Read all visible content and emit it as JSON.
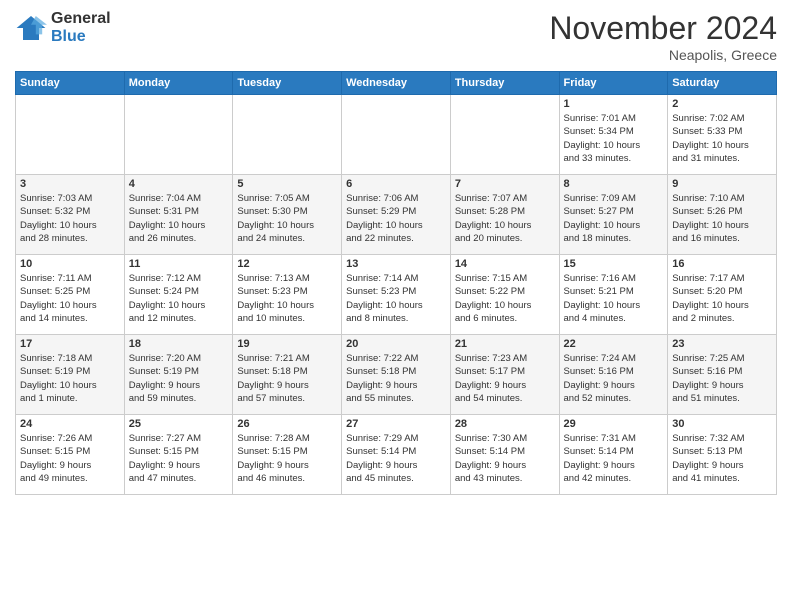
{
  "header": {
    "logo_general": "General",
    "logo_blue": "Blue",
    "month": "November 2024",
    "location": "Neapolis, Greece"
  },
  "days_of_week": [
    "Sunday",
    "Monday",
    "Tuesday",
    "Wednesday",
    "Thursday",
    "Friday",
    "Saturday"
  ],
  "weeks": [
    [
      {
        "day": "",
        "info": ""
      },
      {
        "day": "",
        "info": ""
      },
      {
        "day": "",
        "info": ""
      },
      {
        "day": "",
        "info": ""
      },
      {
        "day": "",
        "info": ""
      },
      {
        "day": "1",
        "info": "Sunrise: 7:01 AM\nSunset: 5:34 PM\nDaylight: 10 hours\nand 33 minutes."
      },
      {
        "day": "2",
        "info": "Sunrise: 7:02 AM\nSunset: 5:33 PM\nDaylight: 10 hours\nand 31 minutes."
      }
    ],
    [
      {
        "day": "3",
        "info": "Sunrise: 7:03 AM\nSunset: 5:32 PM\nDaylight: 10 hours\nand 28 minutes."
      },
      {
        "day": "4",
        "info": "Sunrise: 7:04 AM\nSunset: 5:31 PM\nDaylight: 10 hours\nand 26 minutes."
      },
      {
        "day": "5",
        "info": "Sunrise: 7:05 AM\nSunset: 5:30 PM\nDaylight: 10 hours\nand 24 minutes."
      },
      {
        "day": "6",
        "info": "Sunrise: 7:06 AM\nSunset: 5:29 PM\nDaylight: 10 hours\nand 22 minutes."
      },
      {
        "day": "7",
        "info": "Sunrise: 7:07 AM\nSunset: 5:28 PM\nDaylight: 10 hours\nand 20 minutes."
      },
      {
        "day": "8",
        "info": "Sunrise: 7:09 AM\nSunset: 5:27 PM\nDaylight: 10 hours\nand 18 minutes."
      },
      {
        "day": "9",
        "info": "Sunrise: 7:10 AM\nSunset: 5:26 PM\nDaylight: 10 hours\nand 16 minutes."
      }
    ],
    [
      {
        "day": "10",
        "info": "Sunrise: 7:11 AM\nSunset: 5:25 PM\nDaylight: 10 hours\nand 14 minutes."
      },
      {
        "day": "11",
        "info": "Sunrise: 7:12 AM\nSunset: 5:24 PM\nDaylight: 10 hours\nand 12 minutes."
      },
      {
        "day": "12",
        "info": "Sunrise: 7:13 AM\nSunset: 5:23 PM\nDaylight: 10 hours\nand 10 minutes."
      },
      {
        "day": "13",
        "info": "Sunrise: 7:14 AM\nSunset: 5:23 PM\nDaylight: 10 hours\nand 8 minutes."
      },
      {
        "day": "14",
        "info": "Sunrise: 7:15 AM\nSunset: 5:22 PM\nDaylight: 10 hours\nand 6 minutes."
      },
      {
        "day": "15",
        "info": "Sunrise: 7:16 AM\nSunset: 5:21 PM\nDaylight: 10 hours\nand 4 minutes."
      },
      {
        "day": "16",
        "info": "Sunrise: 7:17 AM\nSunset: 5:20 PM\nDaylight: 10 hours\nand 2 minutes."
      }
    ],
    [
      {
        "day": "17",
        "info": "Sunrise: 7:18 AM\nSunset: 5:19 PM\nDaylight: 10 hours\nand 1 minute."
      },
      {
        "day": "18",
        "info": "Sunrise: 7:20 AM\nSunset: 5:19 PM\nDaylight: 9 hours\nand 59 minutes."
      },
      {
        "day": "19",
        "info": "Sunrise: 7:21 AM\nSunset: 5:18 PM\nDaylight: 9 hours\nand 57 minutes."
      },
      {
        "day": "20",
        "info": "Sunrise: 7:22 AM\nSunset: 5:18 PM\nDaylight: 9 hours\nand 55 minutes."
      },
      {
        "day": "21",
        "info": "Sunrise: 7:23 AM\nSunset: 5:17 PM\nDaylight: 9 hours\nand 54 minutes."
      },
      {
        "day": "22",
        "info": "Sunrise: 7:24 AM\nSunset: 5:16 PM\nDaylight: 9 hours\nand 52 minutes."
      },
      {
        "day": "23",
        "info": "Sunrise: 7:25 AM\nSunset: 5:16 PM\nDaylight: 9 hours\nand 51 minutes."
      }
    ],
    [
      {
        "day": "24",
        "info": "Sunrise: 7:26 AM\nSunset: 5:15 PM\nDaylight: 9 hours\nand 49 minutes."
      },
      {
        "day": "25",
        "info": "Sunrise: 7:27 AM\nSunset: 5:15 PM\nDaylight: 9 hours\nand 47 minutes."
      },
      {
        "day": "26",
        "info": "Sunrise: 7:28 AM\nSunset: 5:15 PM\nDaylight: 9 hours\nand 46 minutes."
      },
      {
        "day": "27",
        "info": "Sunrise: 7:29 AM\nSunset: 5:14 PM\nDaylight: 9 hours\nand 45 minutes."
      },
      {
        "day": "28",
        "info": "Sunrise: 7:30 AM\nSunset: 5:14 PM\nDaylight: 9 hours\nand 43 minutes."
      },
      {
        "day": "29",
        "info": "Sunrise: 7:31 AM\nSunset: 5:14 PM\nDaylight: 9 hours\nand 42 minutes."
      },
      {
        "day": "30",
        "info": "Sunrise: 7:32 AM\nSunset: 5:13 PM\nDaylight: 9 hours\nand 41 minutes."
      }
    ]
  ]
}
